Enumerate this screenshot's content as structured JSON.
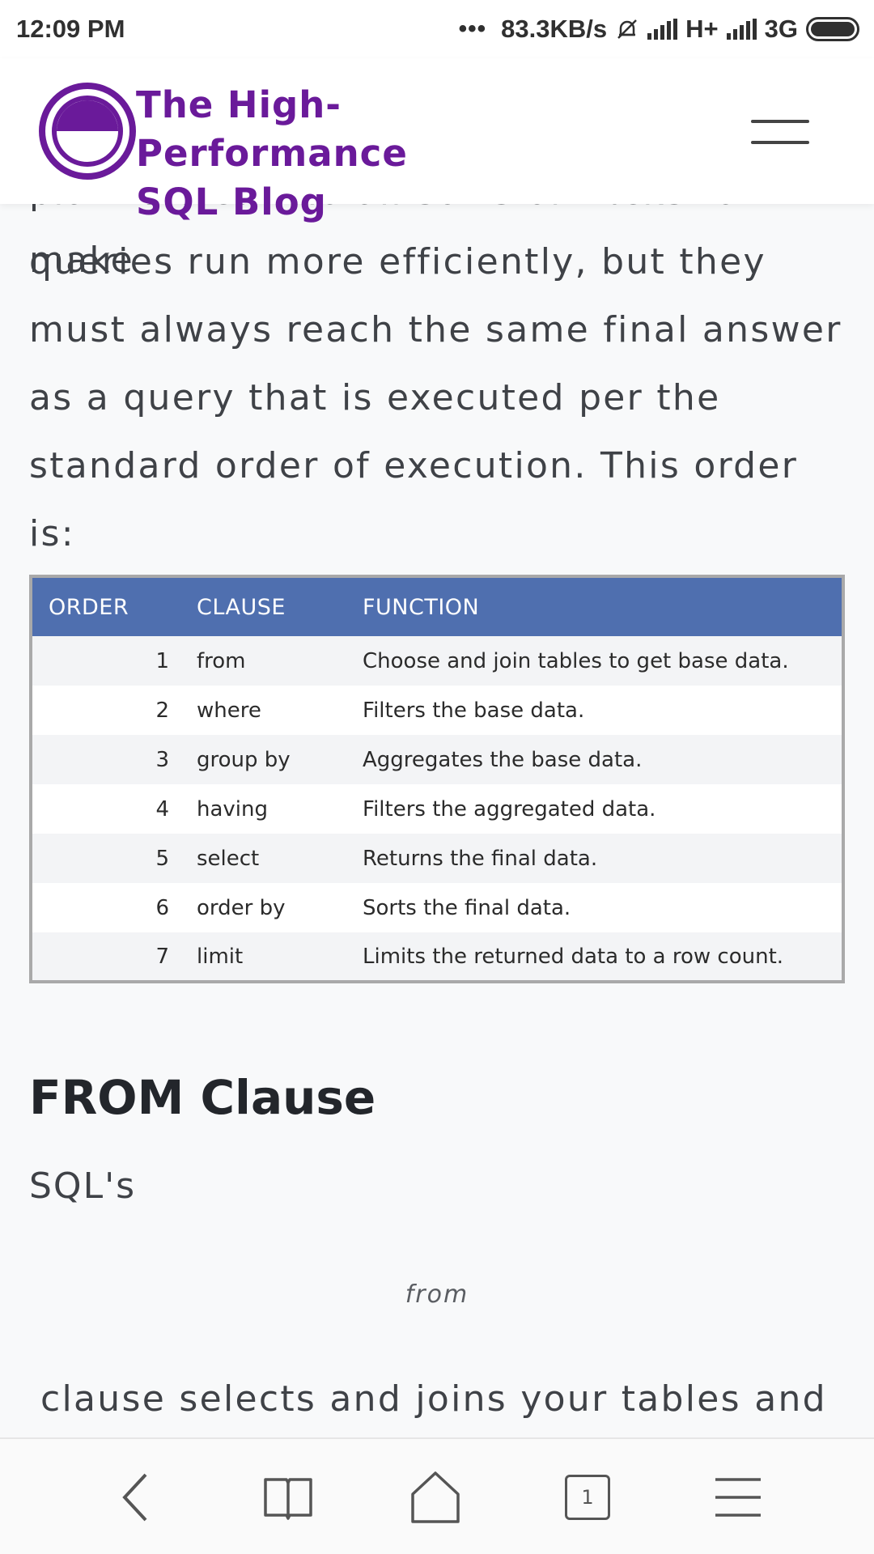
{
  "status_bar": {
    "time": "12:09 PM",
    "dots": "•••",
    "speed": "83.3KB/s",
    "network1": "H+",
    "network2": "3G"
  },
  "header": {
    "site_title_line1": "The High-Performance",
    "site_title_line2": "SQL Blog",
    "brand_color": "#6a1a9a"
  },
  "article": {
    "cut_line": "planners can do all sorts of tricks to make",
    "paragraph_lines": [
      "queries run more efficiently, but they",
      "must always reach the same final answer",
      "as a query that is executed per the",
      "standard order of execution. This order is:"
    ],
    "table": {
      "header_color": "#4f6faf",
      "columns": [
        "ORDER",
        "CLAUSE",
        "FUNCTION"
      ],
      "rows": [
        {
          "order": "1",
          "clause": "from",
          "function": "Choose and join tables to get base data."
        },
        {
          "order": "2",
          "clause": "where",
          "function": "Filters the base data."
        },
        {
          "order": "3",
          "clause": "group by",
          "function": "Aggregates the base data."
        },
        {
          "order": "4",
          "clause": "having",
          "function": "Filters the aggregated data."
        },
        {
          "order": "5",
          "clause": "select",
          "function": "Returns the final data."
        },
        {
          "order": "6",
          "clause": "order by",
          "function": "Sorts the final data."
        },
        {
          "order": "7",
          "clause": "limit",
          "function": "Limits the returned data to a row count."
        }
      ]
    },
    "section_heading": "FROM Clause",
    "sql_text": "SQL's",
    "code_word": "from",
    "clause_text": "clause selects and joins your tables and"
  },
  "bottom_nav": {
    "items": [
      "back-icon",
      "bookmarks-icon",
      "home-icon",
      "tabs-icon",
      "menu-icon"
    ],
    "tab_count": "1"
  }
}
